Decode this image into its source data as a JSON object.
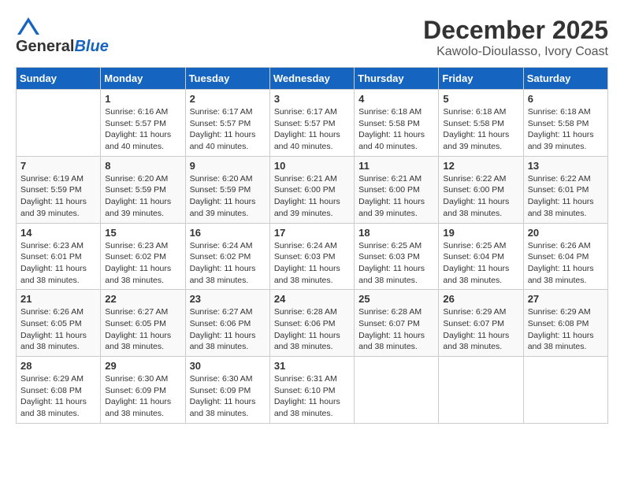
{
  "header": {
    "logo_general": "General",
    "logo_blue": "Blue",
    "title": "December 2025",
    "subtitle": "Kawolo-Dioulasso, Ivory Coast"
  },
  "calendar": {
    "days_of_week": [
      "Sunday",
      "Monday",
      "Tuesday",
      "Wednesday",
      "Thursday",
      "Friday",
      "Saturday"
    ],
    "weeks": [
      [
        {
          "day": "",
          "info": ""
        },
        {
          "day": "1",
          "info": "Sunrise: 6:16 AM\nSunset: 5:57 PM\nDaylight: 11 hours\nand 40 minutes."
        },
        {
          "day": "2",
          "info": "Sunrise: 6:17 AM\nSunset: 5:57 PM\nDaylight: 11 hours\nand 40 minutes."
        },
        {
          "day": "3",
          "info": "Sunrise: 6:17 AM\nSunset: 5:57 PM\nDaylight: 11 hours\nand 40 minutes."
        },
        {
          "day": "4",
          "info": "Sunrise: 6:18 AM\nSunset: 5:58 PM\nDaylight: 11 hours\nand 40 minutes."
        },
        {
          "day": "5",
          "info": "Sunrise: 6:18 AM\nSunset: 5:58 PM\nDaylight: 11 hours\nand 39 minutes."
        },
        {
          "day": "6",
          "info": "Sunrise: 6:18 AM\nSunset: 5:58 PM\nDaylight: 11 hours\nand 39 minutes."
        }
      ],
      [
        {
          "day": "7",
          "info": "Sunrise: 6:19 AM\nSunset: 5:59 PM\nDaylight: 11 hours\nand 39 minutes."
        },
        {
          "day": "8",
          "info": "Sunrise: 6:20 AM\nSunset: 5:59 PM\nDaylight: 11 hours\nand 39 minutes."
        },
        {
          "day": "9",
          "info": "Sunrise: 6:20 AM\nSunset: 5:59 PM\nDaylight: 11 hours\nand 39 minutes."
        },
        {
          "day": "10",
          "info": "Sunrise: 6:21 AM\nSunset: 6:00 PM\nDaylight: 11 hours\nand 39 minutes."
        },
        {
          "day": "11",
          "info": "Sunrise: 6:21 AM\nSunset: 6:00 PM\nDaylight: 11 hours\nand 39 minutes."
        },
        {
          "day": "12",
          "info": "Sunrise: 6:22 AM\nSunset: 6:00 PM\nDaylight: 11 hours\nand 38 minutes."
        },
        {
          "day": "13",
          "info": "Sunrise: 6:22 AM\nSunset: 6:01 PM\nDaylight: 11 hours\nand 38 minutes."
        }
      ],
      [
        {
          "day": "14",
          "info": "Sunrise: 6:23 AM\nSunset: 6:01 PM\nDaylight: 11 hours\nand 38 minutes."
        },
        {
          "day": "15",
          "info": "Sunrise: 6:23 AM\nSunset: 6:02 PM\nDaylight: 11 hours\nand 38 minutes."
        },
        {
          "day": "16",
          "info": "Sunrise: 6:24 AM\nSunset: 6:02 PM\nDaylight: 11 hours\nand 38 minutes."
        },
        {
          "day": "17",
          "info": "Sunrise: 6:24 AM\nSunset: 6:03 PM\nDaylight: 11 hours\nand 38 minutes."
        },
        {
          "day": "18",
          "info": "Sunrise: 6:25 AM\nSunset: 6:03 PM\nDaylight: 11 hours\nand 38 minutes."
        },
        {
          "day": "19",
          "info": "Sunrise: 6:25 AM\nSunset: 6:04 PM\nDaylight: 11 hours\nand 38 minutes."
        },
        {
          "day": "20",
          "info": "Sunrise: 6:26 AM\nSunset: 6:04 PM\nDaylight: 11 hours\nand 38 minutes."
        }
      ],
      [
        {
          "day": "21",
          "info": "Sunrise: 6:26 AM\nSunset: 6:05 PM\nDaylight: 11 hours\nand 38 minutes."
        },
        {
          "day": "22",
          "info": "Sunrise: 6:27 AM\nSunset: 6:05 PM\nDaylight: 11 hours\nand 38 minutes."
        },
        {
          "day": "23",
          "info": "Sunrise: 6:27 AM\nSunset: 6:06 PM\nDaylight: 11 hours\nand 38 minutes."
        },
        {
          "day": "24",
          "info": "Sunrise: 6:28 AM\nSunset: 6:06 PM\nDaylight: 11 hours\nand 38 minutes."
        },
        {
          "day": "25",
          "info": "Sunrise: 6:28 AM\nSunset: 6:07 PM\nDaylight: 11 hours\nand 38 minutes."
        },
        {
          "day": "26",
          "info": "Sunrise: 6:29 AM\nSunset: 6:07 PM\nDaylight: 11 hours\nand 38 minutes."
        },
        {
          "day": "27",
          "info": "Sunrise: 6:29 AM\nSunset: 6:08 PM\nDaylight: 11 hours\nand 38 minutes."
        }
      ],
      [
        {
          "day": "28",
          "info": "Sunrise: 6:29 AM\nSunset: 6:08 PM\nDaylight: 11 hours\nand 38 minutes."
        },
        {
          "day": "29",
          "info": "Sunrise: 6:30 AM\nSunset: 6:09 PM\nDaylight: 11 hours\nand 38 minutes."
        },
        {
          "day": "30",
          "info": "Sunrise: 6:30 AM\nSunset: 6:09 PM\nDaylight: 11 hours\nand 38 minutes."
        },
        {
          "day": "31",
          "info": "Sunrise: 6:31 AM\nSunset: 6:10 PM\nDaylight: 11 hours\nand 38 minutes."
        },
        {
          "day": "",
          "info": ""
        },
        {
          "day": "",
          "info": ""
        },
        {
          "day": "",
          "info": ""
        }
      ]
    ]
  }
}
